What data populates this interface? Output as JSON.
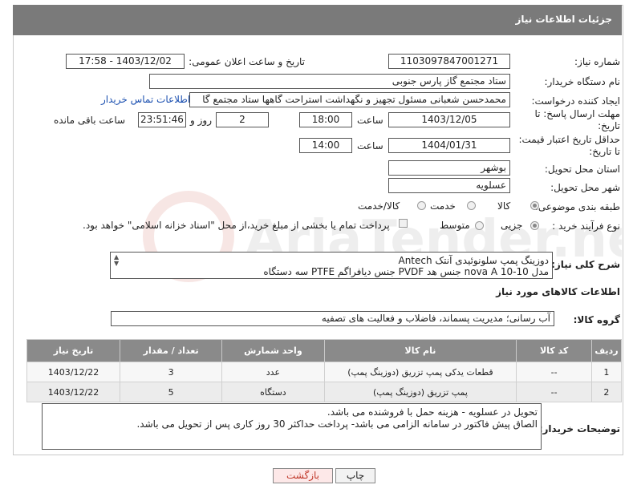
{
  "header": {
    "title": "جزئیات اطلاعات نیاز"
  },
  "watermark": {
    "text": "AriaTender.net"
  },
  "fields": {
    "need_number_label": "شماره نیاز:",
    "need_number": "1103097847001271",
    "announce_label": "تاریخ و ساعت اعلان عمومی:",
    "announce_value": "1403/12/02 - 17:58",
    "buyer_org_label": "نام دستگاه خریدار:",
    "buyer_org": "ستاد مجتمع گاز پارس جنوبی",
    "creator_label": "ایجاد کننده درخواست:",
    "creator": "محمدحسن شعبانی مسئول تجهیز و نگهداشت استراحت گاهها ستاد مجتمع گا",
    "contact_link": "اطلاعات تماس خریدار",
    "deadline_label": "مهلت ارسال پاسخ: تا تاریخ:",
    "deadline_date": "1403/12/05",
    "time_label": "ساعت",
    "deadline_time": "18:00",
    "days_value": "2",
    "days_and_label": "روز و",
    "remaining_time": "23:51:46",
    "remaining_label": "ساعت باقی مانده",
    "price_validity_label": "حداقل تاریخ اعتبار قیمت: تا تاریخ:",
    "price_validity_date": "1404/01/31",
    "price_validity_time": "14:00",
    "province_label": "استان محل تحویل:",
    "province": "بوشهر",
    "city_label": "شهر محل تحویل:",
    "city": "عسلویه",
    "category_label": "طبقه بندی موضوعی:",
    "category_options": [
      "کالا",
      "خدمت",
      "کالا/خدمت"
    ],
    "process_label": "نوع فرآیند خرید :",
    "process_options": [
      "جزیی",
      "متوسط"
    ],
    "payment_note": "پرداخت تمام یا بخشی از مبلغ خرید،از محل \"اسناد خزانه اسلامی\" خواهد بود.",
    "summary_label": "شرح کلی نیاز:",
    "summary_line1": "دوزینگ پمپ سلونوئیدی آنتک Antech",
    "summary_line2": "مدل nova A 10-10 جنس هد PVDF جنس دیافراگم PTFE سه دستگاه",
    "goods_info_title": "اطلاعات کالاهای مورد نیاز",
    "goods_group_label": "گروه کالا:",
    "goods_group": "آب رسانی؛ مدیریت پسماند، فاضلاب و فعالیت های تصفیه",
    "buyer_notes_label": "توضیحات خریدار:",
    "buyer_notes_line1": "تحویل در عسلویه - هزینه حمل با فروشنده می باشد.",
    "buyer_notes_line2": "الصاق پیش فاکتور در سامانه الزامی می باشد- پرداخت حداکثر 30 روز کاری پس از تحویل می باشد."
  },
  "table": {
    "headers": [
      "ردیف",
      "کد کالا",
      "نام کالا",
      "واحد شمارش",
      "تعداد / مقدار",
      "تاریخ نیاز"
    ],
    "rows": [
      [
        "1",
        "--",
        "قطعات یدکی پمپ تزریق (دوزینگ پمپ)",
        "عدد",
        "3",
        "1403/12/22"
      ],
      [
        "2",
        "--",
        "پمپ تزریق (دوزینگ پمپ)",
        "دستگاه",
        "5",
        "1403/12/22"
      ]
    ]
  },
  "buttons": {
    "print": "چاپ",
    "back": "بازگشت"
  },
  "colors": {
    "header_bg": "#7a7a7a",
    "link": "#1a4fb0",
    "back_button_text": "#c0392b"
  }
}
